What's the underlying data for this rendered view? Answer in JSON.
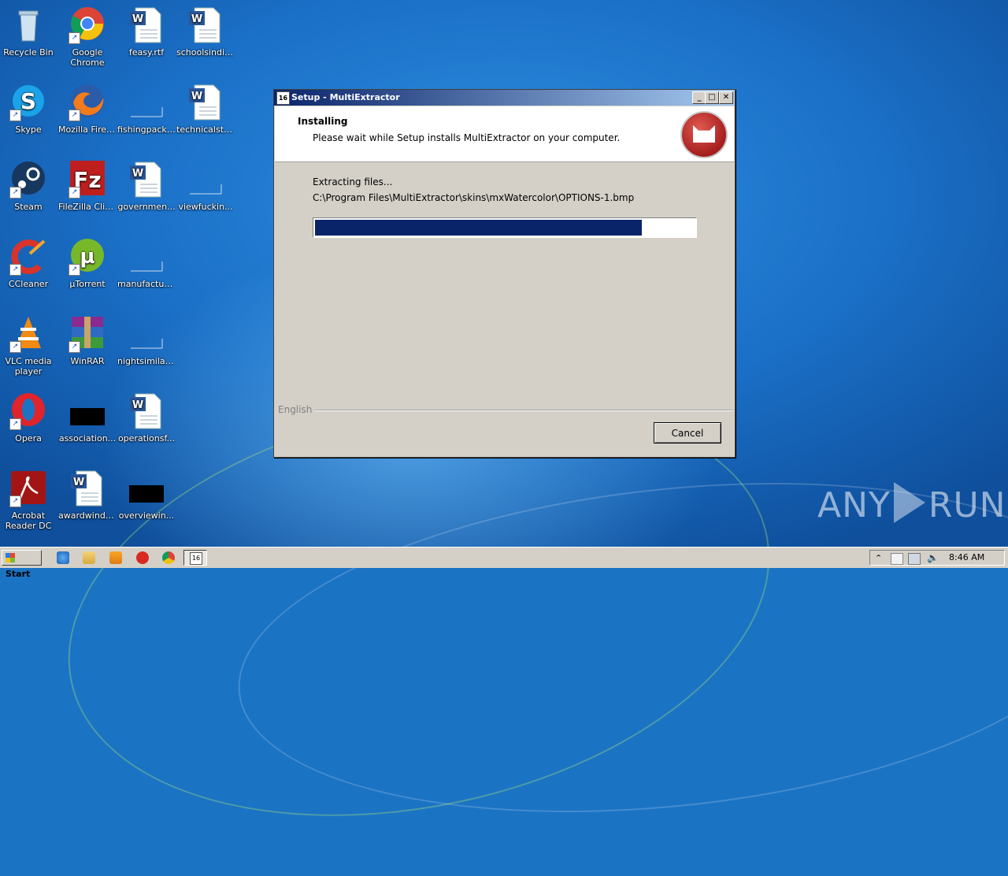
{
  "desktop": {
    "icons": [
      {
        "label": "Recycle Bin"
      },
      {
        "label": "Google Chrome"
      },
      {
        "label": "feasy.rtf"
      },
      {
        "label": "schoolsindivi..."
      },
      {
        "label": "Skype"
      },
      {
        "label": "Mozilla Firefox"
      },
      {
        "label": "fishingpack...."
      },
      {
        "label": "technicalstr..."
      },
      {
        "label": "Steam"
      },
      {
        "label": "FileZilla Client"
      },
      {
        "label": "governmen..."
      },
      {
        "label": "viewfuckin..."
      },
      {
        "label": "CCleaner"
      },
      {
        "label": "µTorrent"
      },
      {
        "label": "manufacturi..."
      },
      {
        "label": "VLC media player"
      },
      {
        "label": "WinRAR"
      },
      {
        "label": "nightsimilar...."
      },
      {
        "label": "Opera"
      },
      {
        "label": "association..."
      },
      {
        "label": "operationsf..."
      },
      {
        "label": "Acrobat Reader DC"
      },
      {
        "label": "awardwind.rtf"
      },
      {
        "label": "overviewin..."
      }
    ]
  },
  "window": {
    "title": "Setup - MultiExtractor",
    "header_title": "Installing",
    "header_subtitle": "Please wait while Setup installs MultiExtractor on your computer.",
    "status": "Extracting files...",
    "current_file": "C:\\Program Files\\MultiExtractor\\skins\\mxWatercolor\\OPTIONS-1.bmp",
    "progress": 0.86,
    "language_label": "English",
    "cancel_label": "Cancel",
    "minimize": "_",
    "maximize": "□",
    "close": "✕"
  },
  "taskbar": {
    "start_label": "Start",
    "clock": "8:46 AM"
  },
  "watermark": {
    "left": "ANY",
    "right": "RUN"
  }
}
